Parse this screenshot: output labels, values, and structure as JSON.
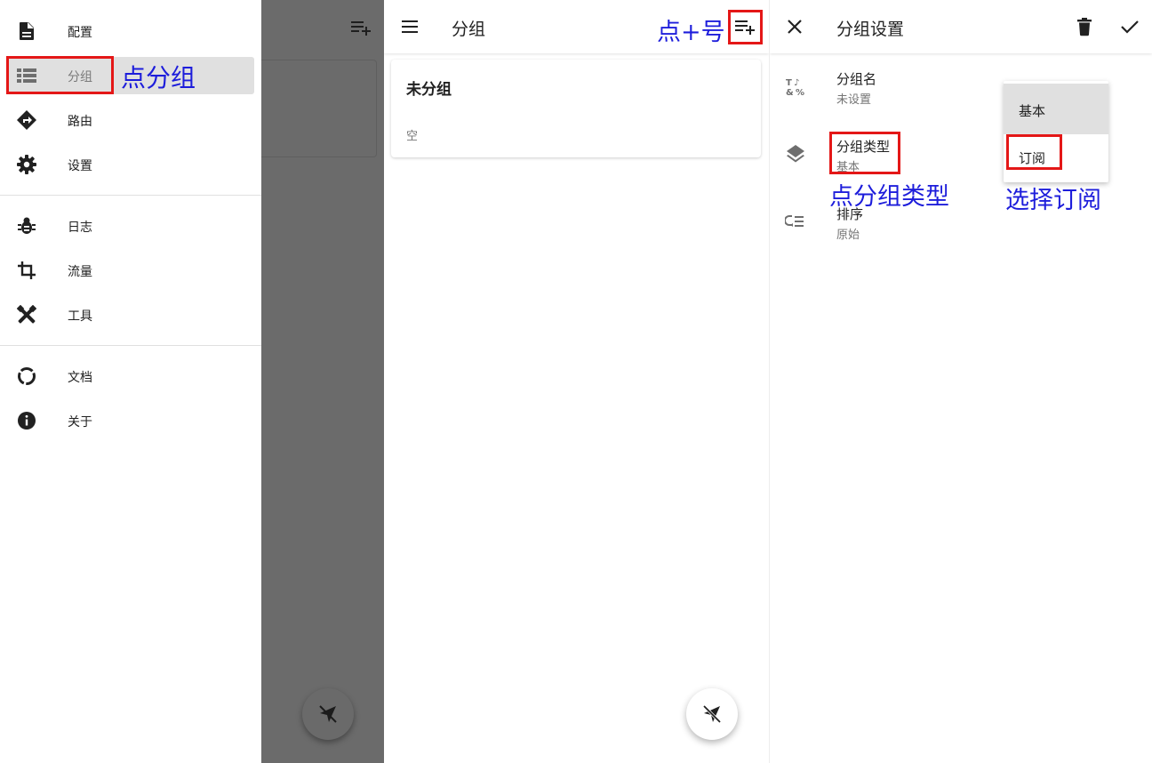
{
  "drawer": {
    "items": [
      {
        "label": "配置",
        "icon": "file-icon"
      },
      {
        "label": "分组",
        "icon": "list-icon"
      },
      {
        "label": "路由",
        "icon": "route-icon"
      },
      {
        "label": "设置",
        "icon": "gear-icon"
      },
      {
        "label": "日志",
        "icon": "bug-icon"
      },
      {
        "label": "流量",
        "icon": "crop-icon"
      },
      {
        "label": "工具",
        "icon": "tools-icon"
      },
      {
        "label": "文档",
        "icon": "donut-icon"
      },
      {
        "label": "关于",
        "icon": "info-icon"
      }
    ],
    "active_index": 1
  },
  "group_list": {
    "title": "分组",
    "card": {
      "title": "未分组",
      "subtitle": "空"
    }
  },
  "group_settings": {
    "title": "分组设置",
    "prefs": [
      {
        "title": "分组名",
        "value": "未设置",
        "icon": "text-format-icon"
      },
      {
        "title": "分组类型",
        "value": "基本",
        "icon": "layers-icon"
      },
      {
        "title": "排序",
        "value": "原始",
        "icon": "sort-icon"
      }
    ],
    "type_menu": {
      "options": [
        "基本",
        "订阅"
      ],
      "selected_index": 0
    }
  },
  "annotations": {
    "tap_group": "点分组",
    "tap_plus": "点+号",
    "tap_group_type": "点分组类型",
    "choose_subscribe": "选择订阅"
  },
  "colors": {
    "highlight_box": "#e41717",
    "annotation_text": "#1d1ddb",
    "scrim": "#6b6b6b",
    "active_item": "#e0e0e0"
  }
}
